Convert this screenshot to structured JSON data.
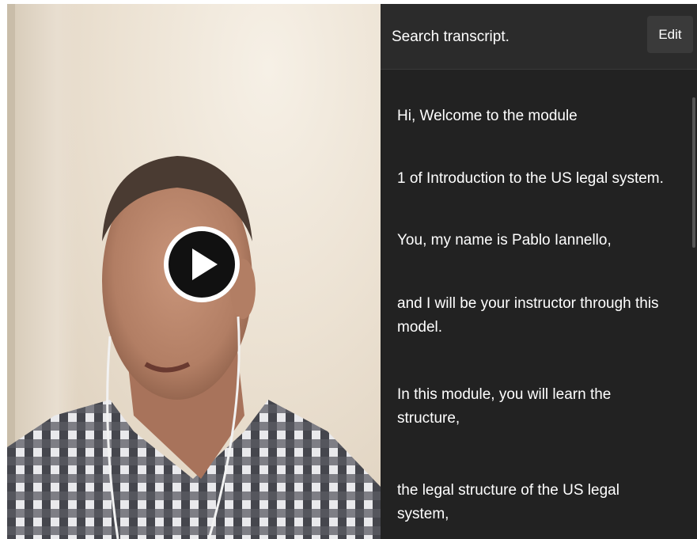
{
  "video": {
    "play_icon": "play-icon"
  },
  "transcript_panel": {
    "search_placeholder": "Search transcript.",
    "edit_label": "Edit",
    "lines": [
      "Hi, Welcome to the module",
      "1 of Introduction to the US legal system.",
      "You, my name is Pablo Iannello,",
      "and I will be your instructor through this model.",
      "In this module, you will learn the structure,",
      "the legal structure of the US legal system,"
    ]
  }
}
